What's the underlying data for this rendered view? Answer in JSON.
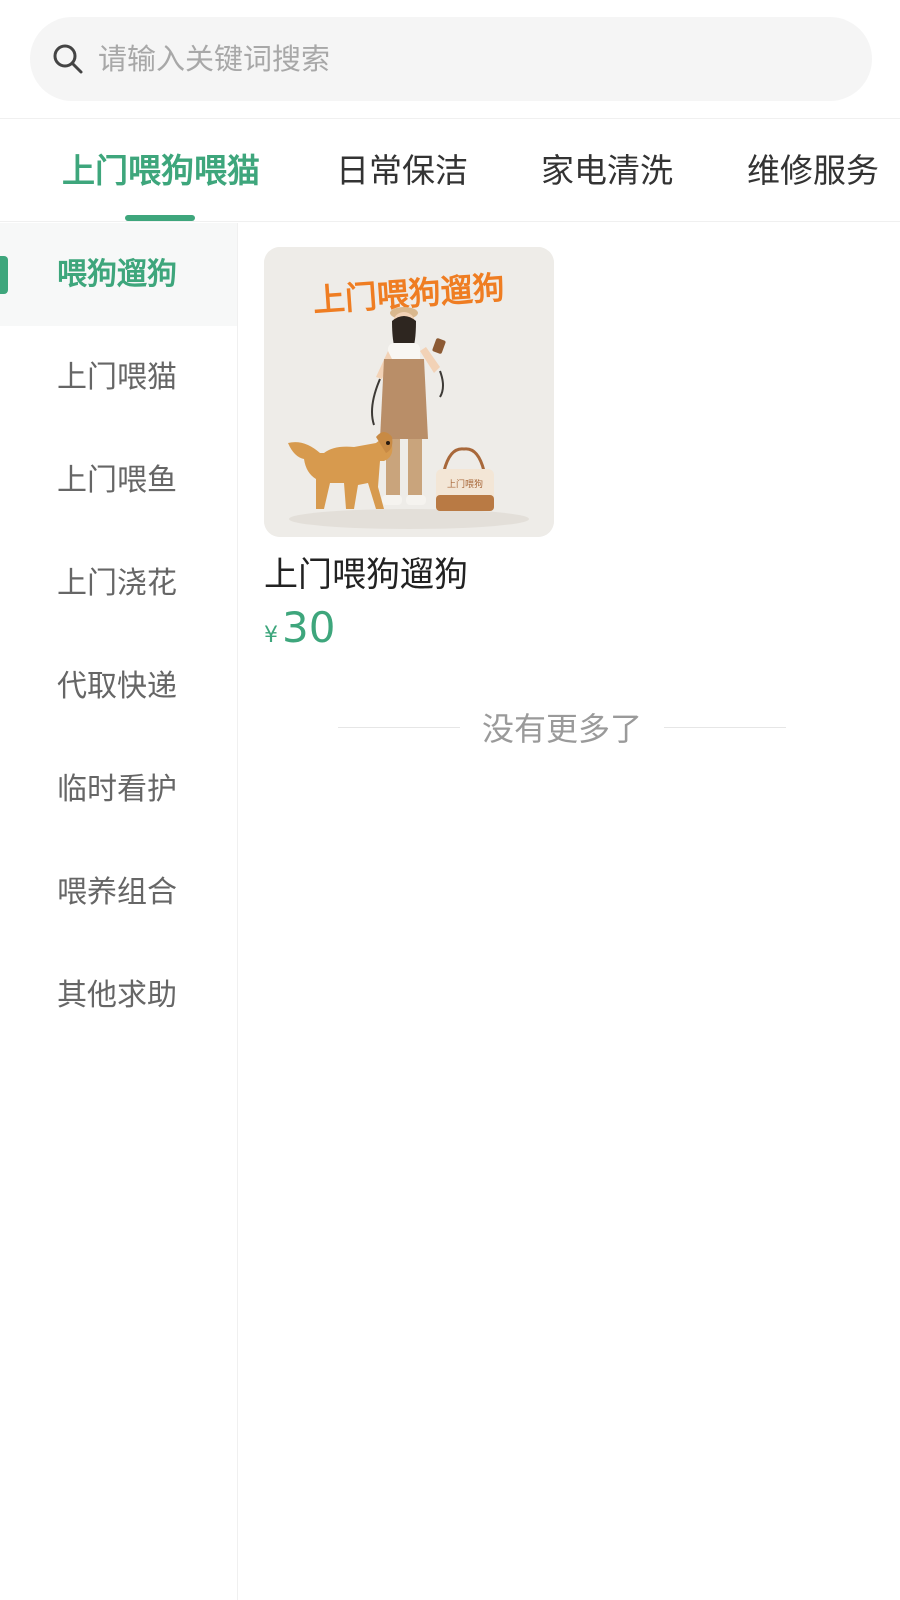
{
  "search": {
    "placeholder": "请输入关键词搜索",
    "icon": "search-icon"
  },
  "tabs": [
    {
      "label": "上门喂狗喂猫",
      "active": true
    },
    {
      "label": "日常保洁",
      "active": false
    },
    {
      "label": "家电清洗",
      "active": false
    },
    {
      "label": "维修服务",
      "active": false
    }
  ],
  "sidebar": {
    "items": [
      {
        "label": "喂狗遛狗",
        "active": true
      },
      {
        "label": "上门喂猫",
        "active": false
      },
      {
        "label": "上门喂鱼",
        "active": false
      },
      {
        "label": "上门浇花",
        "active": false
      },
      {
        "label": "代取快递",
        "active": false
      },
      {
        "label": "临时看护",
        "active": false
      },
      {
        "label": "喂养组合",
        "active": false
      },
      {
        "label": "其他求助",
        "active": false
      }
    ]
  },
  "products": [
    {
      "image_caption": "上门喂狗遛狗",
      "title": "上门喂狗遛狗",
      "currency": "¥",
      "price": "30"
    }
  ],
  "footer": {
    "no_more": "没有更多了"
  },
  "colors": {
    "accent": "#3ea67c",
    "image_caption": "#ef7d22"
  }
}
